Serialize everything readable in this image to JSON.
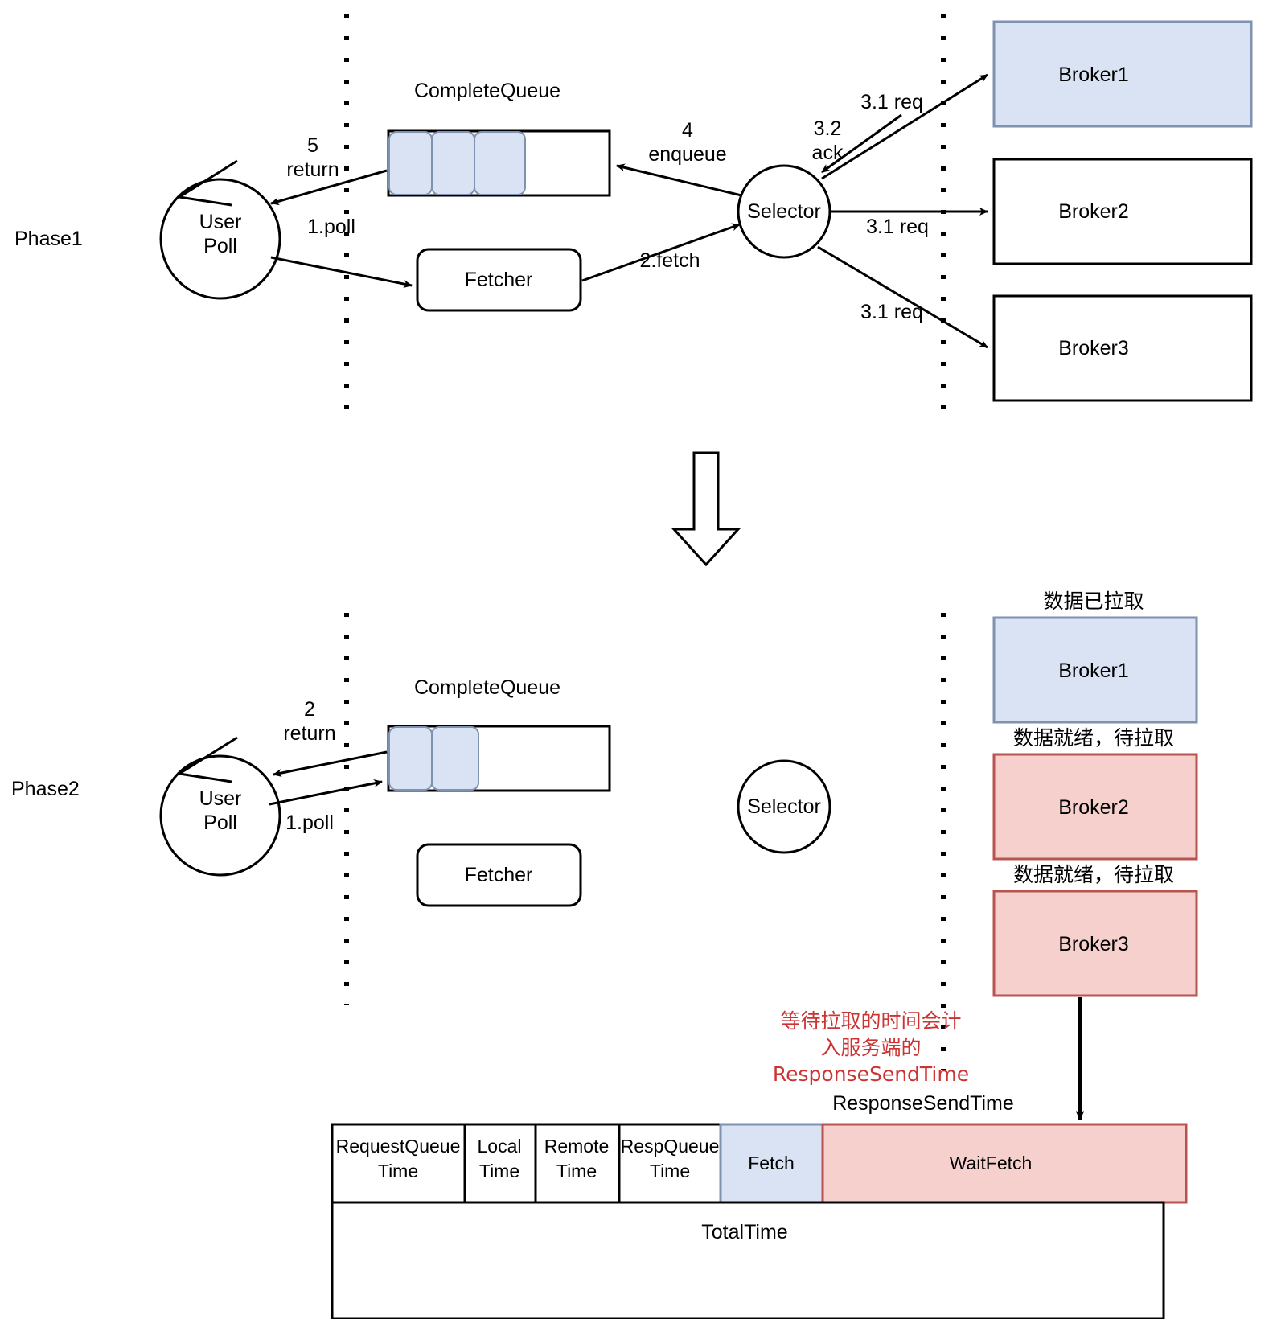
{
  "colors": {
    "blue_fill": "#dae3f3",
    "blue_stroke": "#7f92b0",
    "pink_fill": "#f5d0cd",
    "pink_stroke": "#b85450",
    "stroke": "#000000",
    "red_text": "#cc3333"
  },
  "phase1": {
    "label": "Phase1",
    "nodes": {
      "user_poll_line1": "User",
      "user_poll_line2": "Poll",
      "complete_queue_title": "CompleteQueue",
      "fetcher": "Fetcher",
      "selector": "Selector",
      "broker1": "Broker1",
      "broker2": "Broker2",
      "broker3": "Broker3"
    },
    "queue_filled_cells": 3,
    "edges": {
      "return_num": "5",
      "return_word": "return",
      "poll": "1.poll",
      "fetch": "2.fetch",
      "enqueue_num": "4",
      "enqueue_word": "enqueue",
      "req_b1": "3.1 req",
      "ack_num": "3.2",
      "ack_word": "ack",
      "req_b2": "3.1 req",
      "req_b3": "3.1 req"
    }
  },
  "phase2": {
    "label": "Phase2",
    "nodes": {
      "user_poll_line1": "User",
      "user_poll_line2": "Poll",
      "complete_queue_title": "CompleteQueue",
      "fetcher": "Fetcher",
      "selector": "Selector",
      "broker1": "Broker1",
      "broker2": "Broker2",
      "broker3": "Broker3"
    },
    "queue_filled_cells": 2,
    "edges": {
      "return_num": "2",
      "return_word": "return",
      "poll": "1.poll"
    },
    "broker_status": {
      "broker1": "数据已拉取",
      "broker2": "数据就绪，待拉取",
      "broker3": "数据就绪，待拉取"
    }
  },
  "annotation": {
    "line1": "等待拉取的时间会计",
    "line2": "入服务端的",
    "line3": "ResponseSendTime"
  },
  "timeline": {
    "response_send_time_label": "ResponseSendTime",
    "total_time_label": "TotalTime",
    "segments": [
      {
        "line1": "RequestQueue",
        "line2": "Time",
        "fill": "#ffffff",
        "stroke": "#000000"
      },
      {
        "line1": "Local",
        "line2": "Time",
        "fill": "#ffffff",
        "stroke": "#000000"
      },
      {
        "line1": "Remote",
        "line2": "Time",
        "fill": "#ffffff",
        "stroke": "#000000"
      },
      {
        "line1": "RespQueue",
        "line2": "Time",
        "fill": "#ffffff",
        "stroke": "#000000"
      },
      {
        "line1": "Fetch",
        "line2": "",
        "fill": "#dae3f3",
        "stroke": "#7f92b0"
      },
      {
        "line1": "WaitFetch",
        "line2": "",
        "fill": "#f5d0cd",
        "stroke": "#b85450"
      }
    ]
  }
}
